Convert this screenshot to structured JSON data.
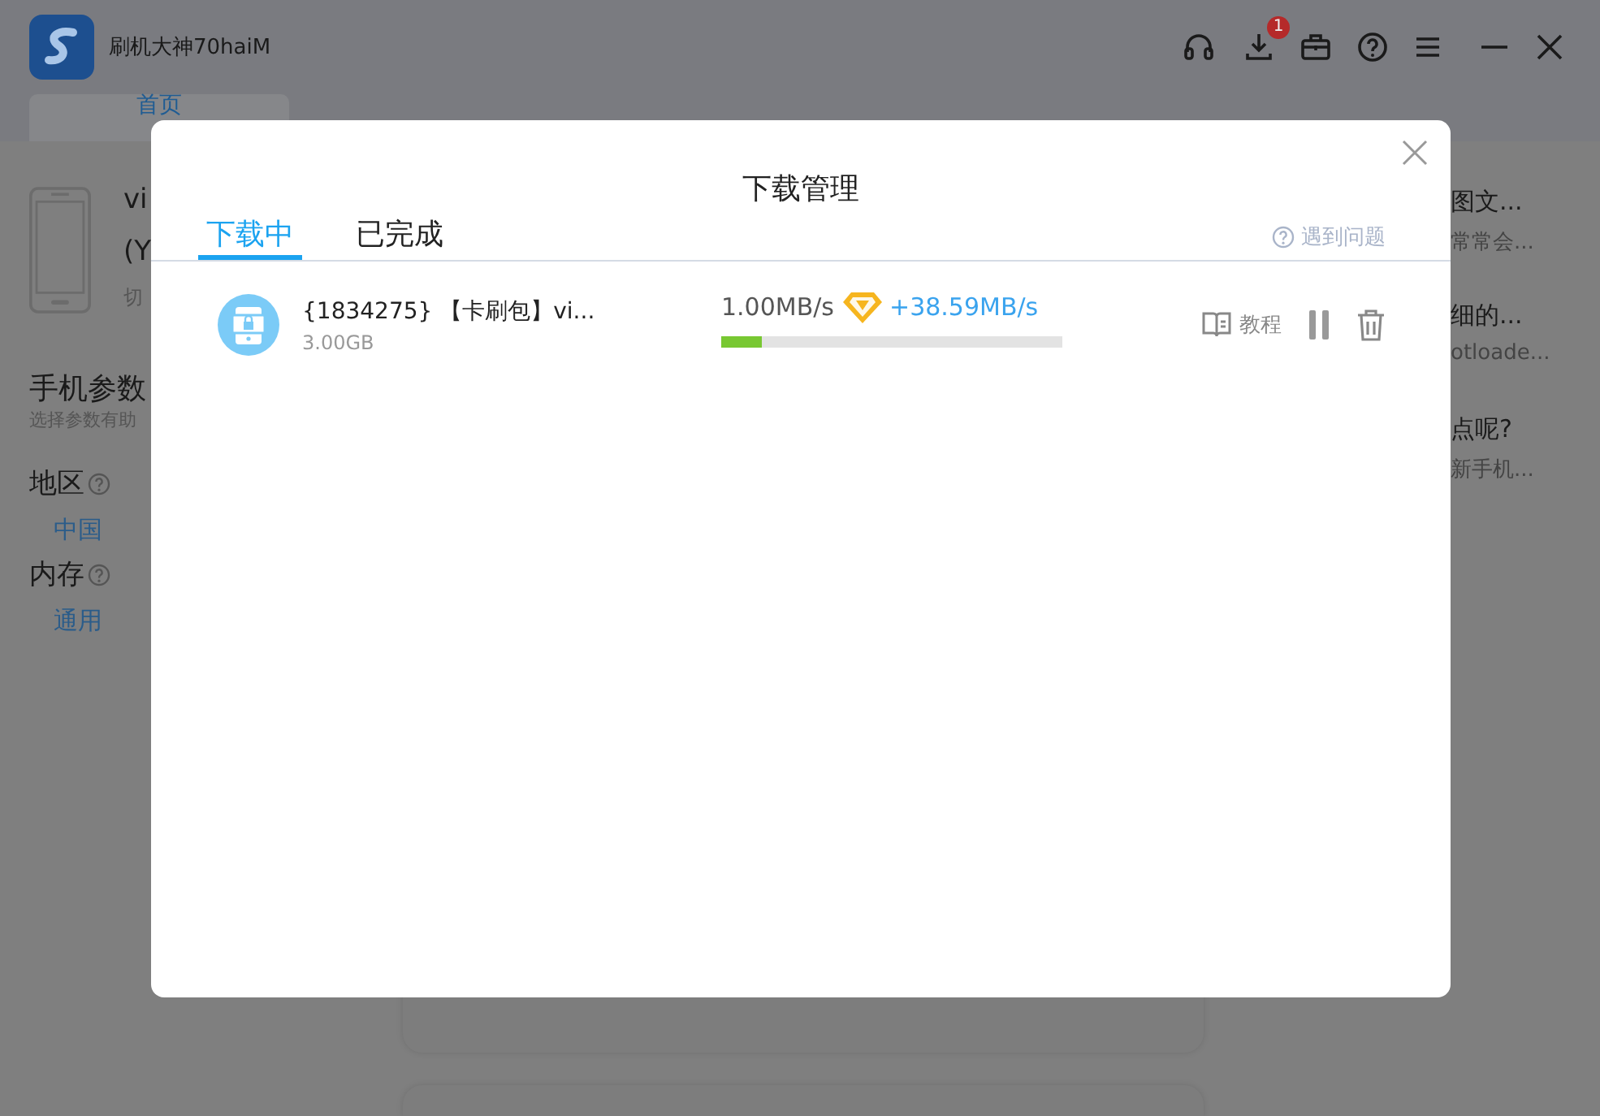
{
  "app": {
    "name": "刷机大神70haiM",
    "download_badge": "1",
    "home_tab": {
      "label": "首页",
      "selected": true
    }
  },
  "device": {
    "name": "vi",
    "model": "(Y",
    "switch": "切"
  },
  "params": {
    "title": "手机参数",
    "subtitle": "选择参数有助",
    "fields": [
      {
        "label": "地区",
        "value": "中国"
      },
      {
        "label": "内存",
        "value": "通用"
      }
    ]
  },
  "articles": [
    {
      "title": "图文...",
      "summary": "常常会..."
    },
    {
      "title": "细的...",
      "summary": "otloade..."
    },
    {
      "title": "点呢?",
      "summary": "新手机..."
    }
  ],
  "dialog": {
    "title": "下载管理",
    "tabs": [
      {
        "label": "下载中",
        "selected": true
      },
      {
        "label": "已完成",
        "selected": false
      }
    ],
    "help": "遇到问题",
    "downloads": [
      {
        "name": "{1834275} 【卡刷包】vi...",
        "size": "3.00GB",
        "speed": "1.00MB/s",
        "boost": "+38.59MB/s",
        "level": 0.12,
        "tutorial": "教程",
        "paused": false
      }
    ]
  }
}
